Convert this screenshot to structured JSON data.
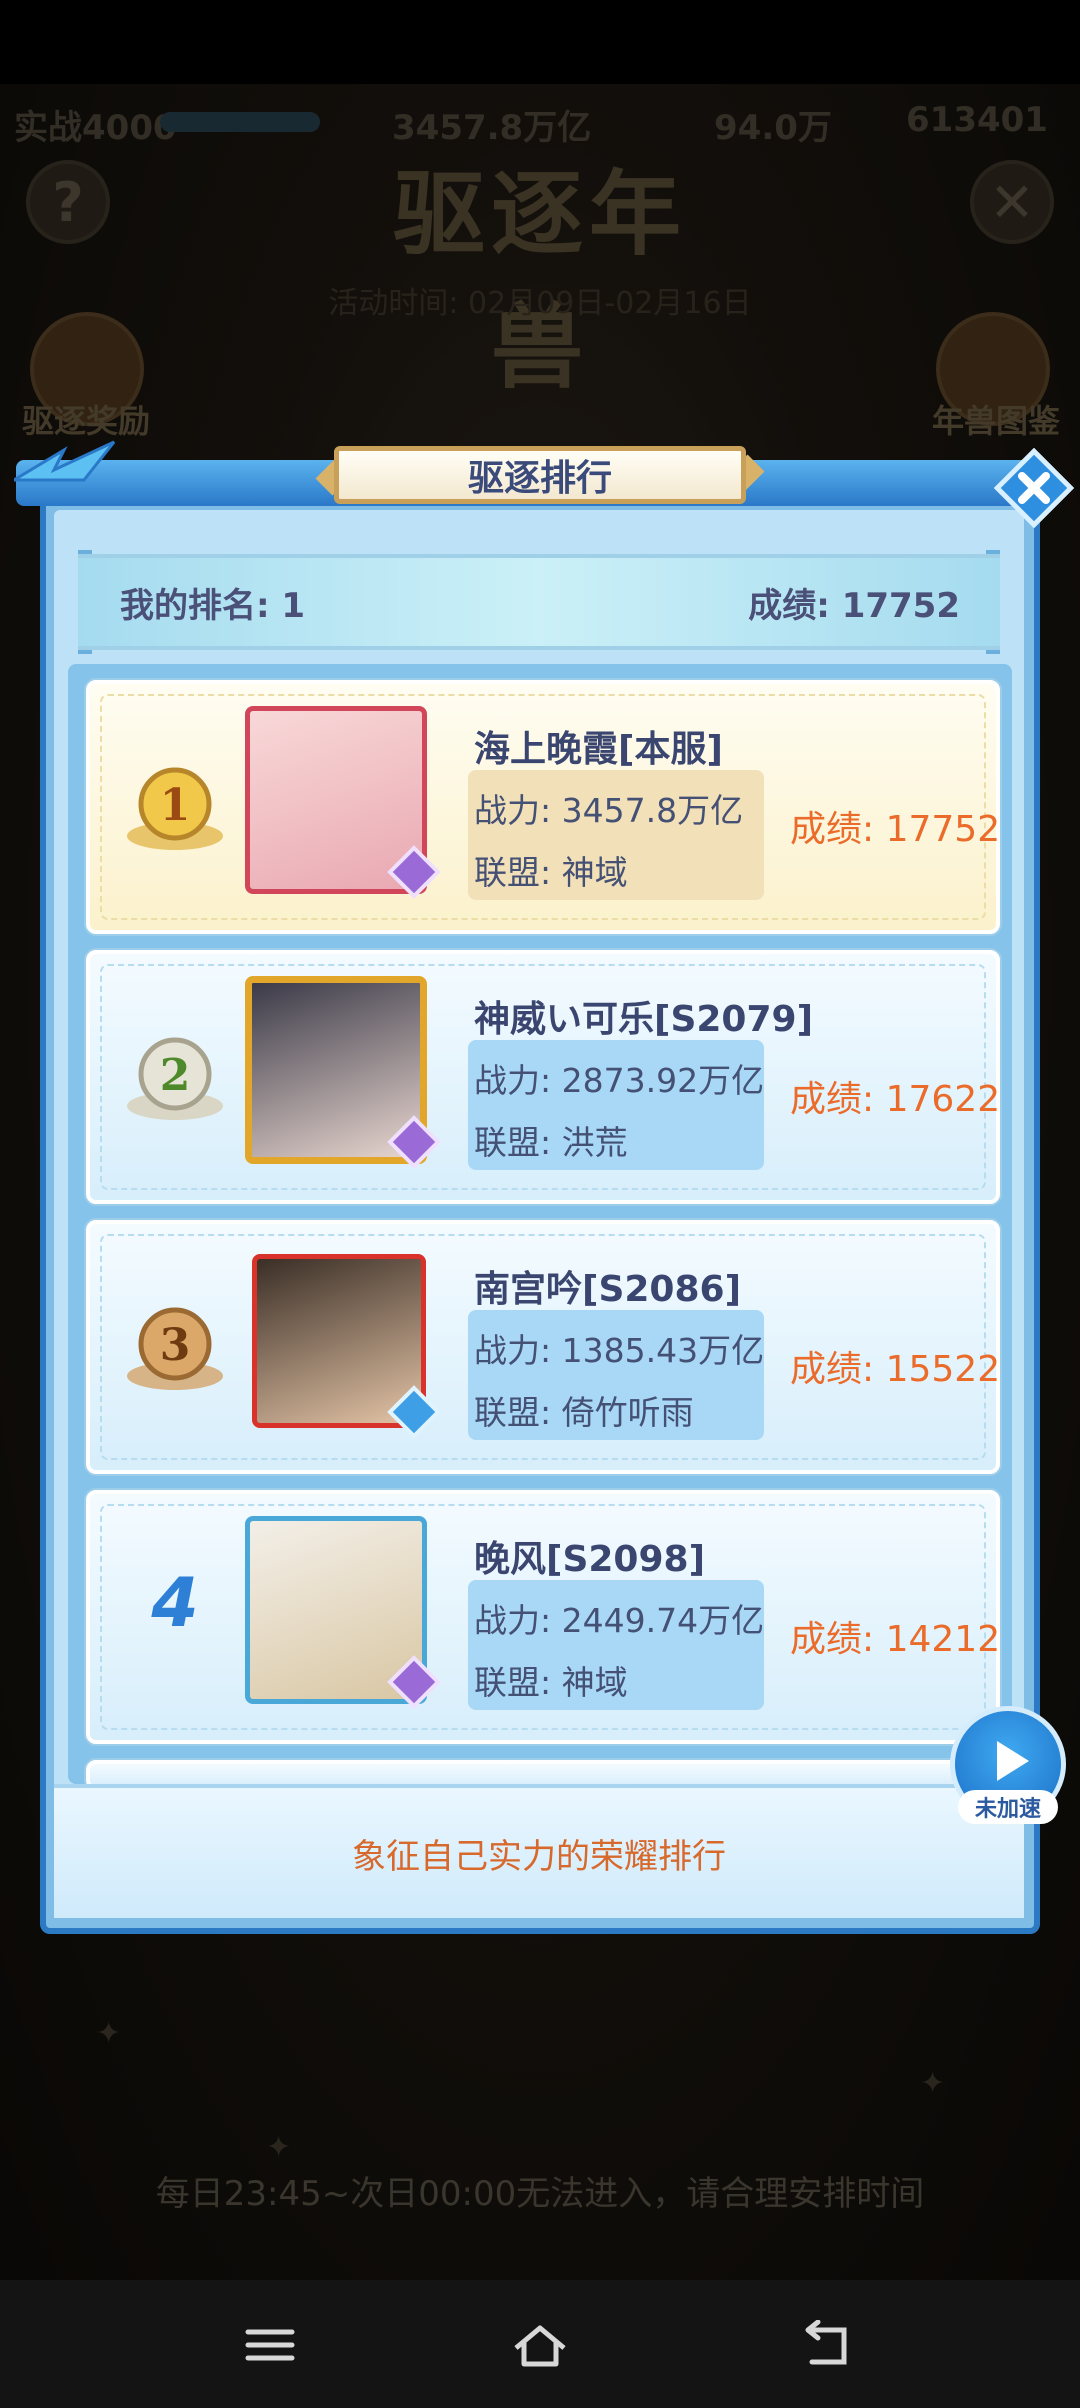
{
  "background": {
    "status_left": "实战4000",
    "status_mid": "3457.8万亿",
    "status_right_1": "94.0万",
    "status_right_2": "613401",
    "help_icon": "question-icon",
    "close_icon": "close-icon",
    "title": "驱逐年兽",
    "subtitle": "活动时间: 02月09日-02月16日",
    "left_button_label": "驱逐奖励",
    "right_button_label": "年兽图鉴",
    "notice": "每日23:45~次日00:00无法进入，请合理安排时间"
  },
  "panel": {
    "title": "驱逐排行",
    "my_rank_label": "我的排名: 1",
    "my_score_label": "成绩: 17752",
    "footer_text": "象征自己实力的荣耀排行"
  },
  "ranking": [
    {
      "rank": "1",
      "name": "海上晚霞[本服]",
      "power": "战力: 3457.8万亿",
      "alliance": "联盟: 神域",
      "score": "成绩: 17752"
    },
    {
      "rank": "2",
      "name": "神威い可乐[S2079]",
      "power": "战力: 2873.92万亿",
      "alliance": "联盟: 洪荒",
      "score": "成绩: 17622"
    },
    {
      "rank": "3",
      "name": "南宫吟[S2086]",
      "power": "战力: 1385.43万亿",
      "alliance": "联盟: 倚竹听雨",
      "score": "成绩: 15522"
    },
    {
      "rank": "4",
      "name": "晚风[S2098]",
      "power": "战力: 2449.74万亿",
      "alliance": "联盟: 神域",
      "score": "成绩: 14212"
    }
  ],
  "speed_button": {
    "label": "未加速",
    "icon": "play-icon"
  },
  "nav": {
    "menu_icon": "menu-icon",
    "home_icon": "home-icon",
    "back_icon": "back-icon"
  },
  "colors": {
    "score": "#ea6b2a",
    "panel_border": "#2d7ac4",
    "name": "#3a4670",
    "first_row": "#fbf1cc"
  }
}
